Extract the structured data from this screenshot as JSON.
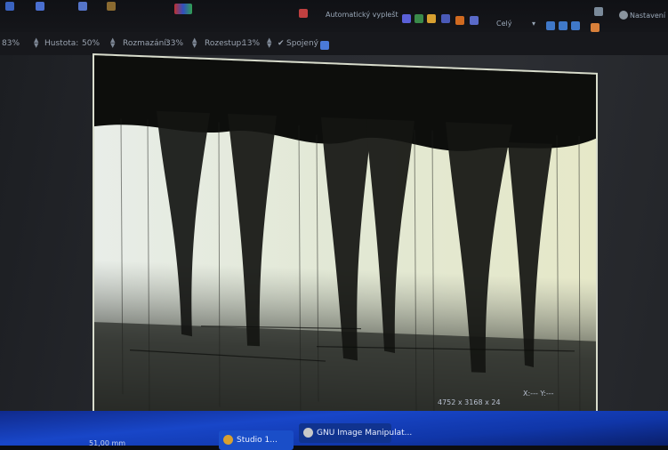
{
  "toolbar_top": {
    "autofill_label": "Automatický vyplešt",
    "view_select_value": "Celý",
    "restore_label": "Nastavení"
  },
  "options": {
    "zoom_value": "83%",
    "density_label": "Hustota:",
    "density_value": "50%",
    "blur_label": "Rozmazání:",
    "blur_value": "33%",
    "spacing_label": "Rozestup:",
    "spacing_value": "13%",
    "joined_label": "Spojený"
  },
  "status": {
    "image_size": "4752 x 3168 x 24",
    "coords_readout": "X:--- Y:---",
    "ruler_value": "51,00 mm"
  },
  "taskbar": {
    "app1_label": "Studio 1...",
    "app2_label": "GNU Image Manipulat..."
  },
  "colors": {
    "taskbar_blue": "#1846c8",
    "photo_border": "#d8dccc"
  }
}
